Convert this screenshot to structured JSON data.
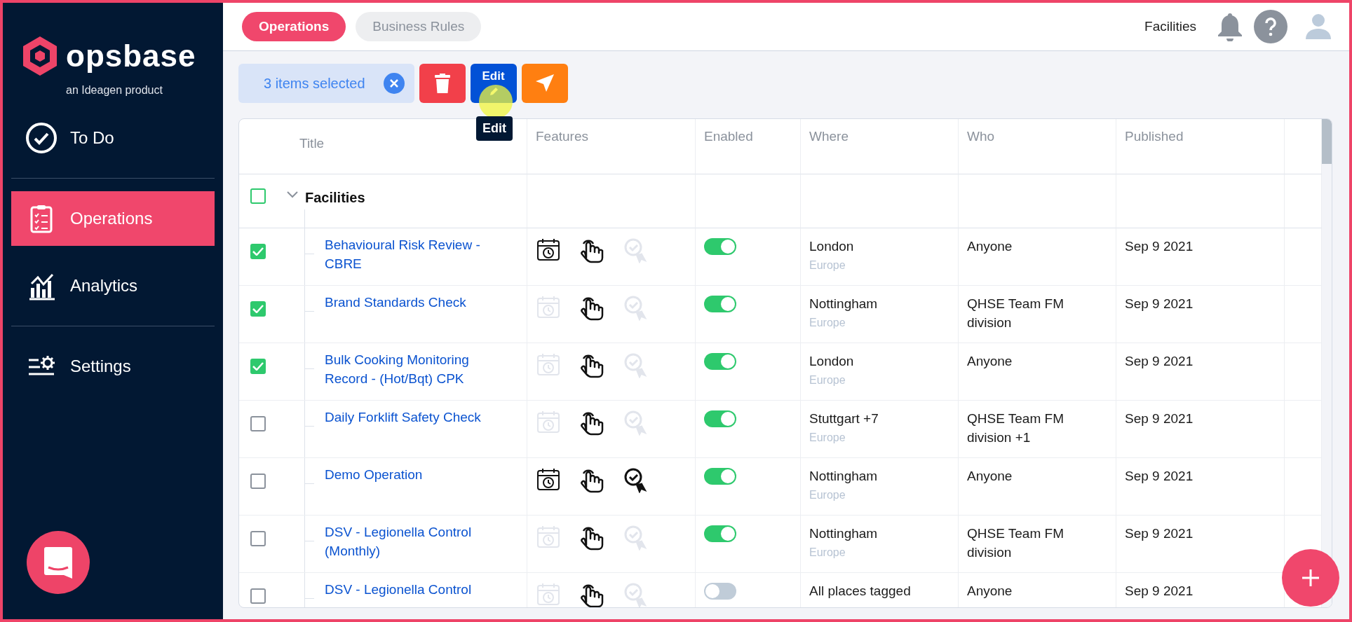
{
  "brand": {
    "name": "opsbase",
    "tagline": "an Ideagen product"
  },
  "sidebar": {
    "items": [
      {
        "label": "To Do",
        "selected": false
      },
      {
        "label": "Operations",
        "selected": true
      },
      {
        "label": "Analytics",
        "selected": false
      },
      {
        "label": "Settings",
        "selected": false
      }
    ]
  },
  "tabs": [
    {
      "label": "Operations",
      "selected": true
    },
    {
      "label": "Business Rules",
      "selected": false
    }
  ],
  "header": {
    "context": "Facilities"
  },
  "selection": {
    "label": "3 items selected"
  },
  "actions": {
    "edit_label": "Edit",
    "tooltip": "Edit"
  },
  "table": {
    "columns": [
      "Title",
      "Features",
      "Enabled",
      "Where",
      "Who",
      "Published"
    ],
    "group": {
      "label": "Facilities",
      "checked": false,
      "expanded": true
    },
    "rows": [
      {
        "title": "Behavioural Risk Review - CBRE",
        "checked": true,
        "scheduled": true,
        "interactive": true,
        "certified": false,
        "enabled": true,
        "where": "London",
        "region": "Europe",
        "who": "Anyone",
        "published": "Sep 9 2021"
      },
      {
        "title": "Brand Standards Check",
        "checked": true,
        "scheduled": false,
        "interactive": true,
        "certified": false,
        "enabled": true,
        "where": "Nottingham",
        "region": "Europe",
        "who": "QHSE Team FM division",
        "published": "Sep 9 2021"
      },
      {
        "title": "Bulk Cooking Monitoring Record - (Hot/Bqt) CPK",
        "checked": true,
        "scheduled": false,
        "interactive": true,
        "certified": false,
        "enabled": true,
        "where": "London",
        "region": "Europe",
        "who": "Anyone",
        "published": "Sep 9 2021"
      },
      {
        "title": "Daily Forklift Safety Check",
        "checked": false,
        "scheduled": false,
        "interactive": true,
        "certified": false,
        "enabled": true,
        "where": "Stuttgart +7",
        "region": "Europe",
        "who": "QHSE Team FM division +1",
        "published": "Sep 9 2021"
      },
      {
        "title": "Demo Operation",
        "checked": false,
        "scheduled": true,
        "interactive": true,
        "certified": true,
        "enabled": true,
        "where": "Nottingham",
        "region": "Europe",
        "who": "Anyone",
        "published": "Sep 9 2021"
      },
      {
        "title": "DSV - Legionella Control (Monthly)",
        "checked": false,
        "scheduled": false,
        "interactive": true,
        "certified": false,
        "enabled": true,
        "where": "Nottingham",
        "region": "Europe",
        "who": "QHSE Team FM division",
        "published": "Sep 9 2021"
      },
      {
        "title": "DSV - Legionella Control",
        "checked": false,
        "scheduled": false,
        "interactive": true,
        "certified": false,
        "enabled": false,
        "where": "All places tagged",
        "who": "Anyone",
        "published": "Sep 9 2021"
      }
    ]
  }
}
